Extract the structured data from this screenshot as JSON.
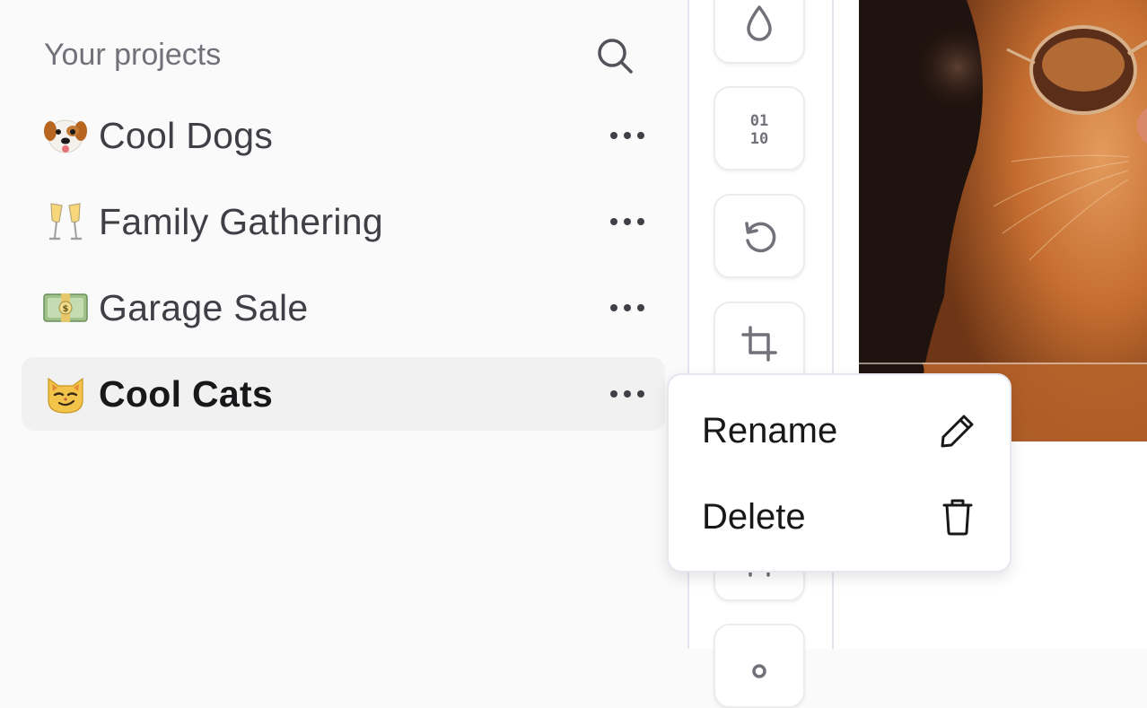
{
  "sidebar": {
    "title": "Your projects",
    "search_icon": "search-icon",
    "projects": [
      {
        "emoji": "dog-face",
        "name": "Cool Dogs",
        "active": false
      },
      {
        "emoji": "champagne-glasses",
        "name": "Family Gathering",
        "active": false
      },
      {
        "emoji": "dollar-banknote",
        "name": "Garage Sale",
        "active": false
      },
      {
        "emoji": "smirking-cat-face",
        "name": "Cool Cats",
        "active": true
      }
    ]
  },
  "toolbar": {
    "tools": [
      "drop-icon",
      "binary-icon",
      "rotate-icon",
      "crop-icon",
      "grid-icon",
      "pin-icon"
    ],
    "binary_text": {
      "top": "01",
      "bottom": "10"
    }
  },
  "context_menu": {
    "items": [
      {
        "label": "Rename",
        "icon": "pencil-icon"
      },
      {
        "label": "Delete",
        "icon": "trash-icon"
      }
    ]
  },
  "colors": {
    "accent_text": "#18181b",
    "muted_text": "#71717a",
    "active_row": "#f1f1f1",
    "divider": "#e2e5ef"
  }
}
